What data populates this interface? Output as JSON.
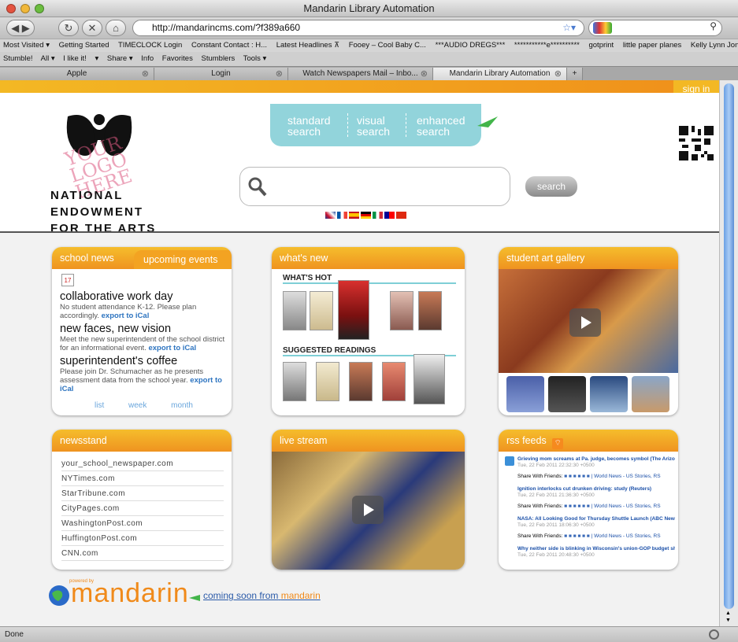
{
  "window": {
    "title": "Mandarin Library Automation"
  },
  "browser": {
    "url": "http://mandarincms.com/?f389a660",
    "bookmarks": [
      "Most Visited ▾",
      "Getting Started",
      "TIMECLOCK Login",
      "Constant Contact : H...",
      "Latest Headlines ⊼",
      "Fooey – Cool Baby C...",
      "***AUDIO DREGS***",
      "***********e**********",
      "gotprint",
      "little paper planes",
      "Kelly Lynn Jones"
    ],
    "toolbar2": [
      "Stumble!",
      "All ▾",
      "I like it!",
      "▾",
      "Share ▾",
      "Info",
      "Favorites",
      "Stumblers",
      "Tools ▾"
    ],
    "tabs": [
      "Apple",
      "Login",
      "Watch Newspapers Mail – Inbo...",
      "Mandarin Library Automation"
    ],
    "status": "Done"
  },
  "header": {
    "signin": "sign in",
    "modes": [
      "standard search",
      "visual search",
      "enhanced search"
    ],
    "search_button": "search",
    "logo_lines": [
      "NATIONAL",
      "ENDOWMENT",
      "FOR THE ARTS"
    ],
    "logo_watermark": "YOUR LOGO HERE"
  },
  "school": {
    "tab1": "school news",
    "tab2": "upcoming events",
    "date": "17",
    "items": [
      {
        "title": "collaborative work day",
        "desc": "No student attendance K-12. Please plan accordingly.",
        "link": "export to iCal"
      },
      {
        "title": "new faces, new vision",
        "desc": "Meet the new superintendent of the school district for an informational event.",
        "link": "export to iCal"
      },
      {
        "title": "superintendent's coffee",
        "desc": "Please join Dr. Schumacher as he presents assessment data from the school year.",
        "link": "export to iCal"
      }
    ],
    "views": [
      "list",
      "week",
      "month"
    ]
  },
  "whatsnew": {
    "title": "what's new",
    "hot": "WHAT'S HOT",
    "suggested": "SUGGESTED READINGS"
  },
  "gallery": {
    "title": "student art gallery"
  },
  "newsstand": {
    "title": "newsstand",
    "items": [
      "your_school_newspaper.com",
      "NYTimes.com",
      "StarTribune.com",
      "CityPages.com",
      "WashingtonPost.com",
      "HuffingtonPost.com",
      "CNN.com"
    ]
  },
  "livestream": {
    "title": "live stream"
  },
  "rss": {
    "title": "rss feeds",
    "items": [
      {
        "headline": "Grieving mom screams at Pa. judge, becomes symbol (The Arizona Repu",
        "date": "Tue, 22 Feb 2011 22:32:30 +0500"
      },
      {
        "headline": "Ignition interlocks cut drunken driving: study (Reuters)",
        "date": "Tue, 22 Feb 2011 21:36:30 +0500"
      },
      {
        "headline": "NASA: All Looking Good for Thursday Shuttle Launch (ABC News)",
        "date": "Tue, 22 Feb 2011 18:06:30 +0500"
      },
      {
        "headline": "Why neither side is blinking in Wisconsin's union-GOP budget showdow",
        "date": "Tue, 22 Feb 2011 20:48:30 +0500"
      }
    ],
    "share": "Share With Friends:",
    "source": "| World News - US Stories, RS"
  },
  "footer": {
    "powered": "powered by",
    "brand": "mandarin",
    "link": "coming soon from",
    "link2": "mandarin"
  }
}
